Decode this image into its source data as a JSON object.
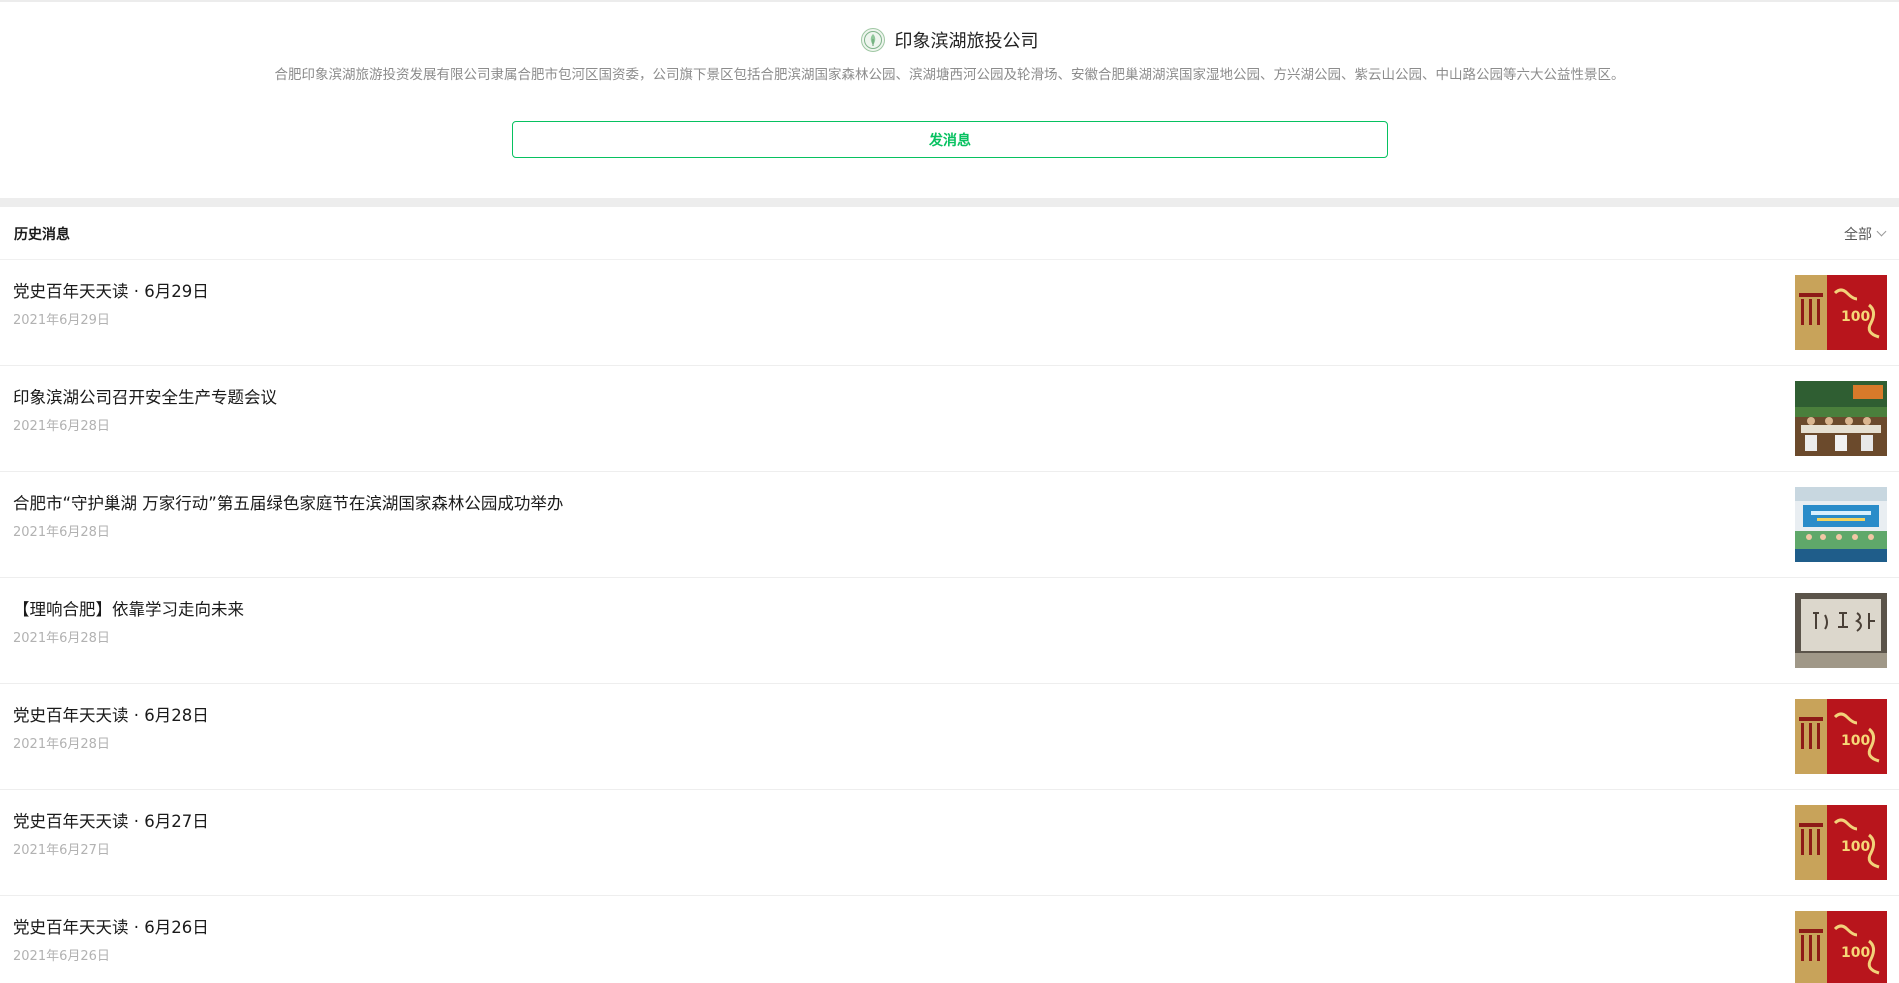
{
  "account": {
    "name": "印象滨湖旅投公司",
    "logo_icon": "green-circular-logo-icon",
    "description": "合肥印象滨湖旅游投资发展有限公司隶属合肥市包河区国资委，公司旗下景区包括合肥滨湖国家森林公园、滨湖塘西河公园及轮滑场、安徽合肥巢湖湖滨国家湿地公园、方兴湖公园、紫云山公园、中山路公园等六大公益性景区。",
    "send_message_label": "发消息",
    "accent_color": "#07c160"
  },
  "history": {
    "title": "历史消息",
    "filter_label": "全部",
    "filter_icon": "chevron-down-icon",
    "items": [
      {
        "title": "党史百年天天读 · 6月29日",
        "date": "2021年6月29日",
        "thumb": "party-history-100-years-thumbnail"
      },
      {
        "title": "印象滨湖公司召开安全生产专题会议",
        "date": "2021年6月28日",
        "thumb": "meeting-room-photo-thumbnail"
      },
      {
        "title": "合肥市“守护巢湖 万家行动”第五届绿色家庭节在滨湖国家森林公园成功举办",
        "date": "2021年6月28日",
        "thumb": "stage-event-photo-thumbnail"
      },
      {
        "title": "【理响合肥】依靠学习走向未来",
        "date": "2021年6月28日",
        "thumb": "calligraphy-wall-photo-thumbnail"
      },
      {
        "title": "党史百年天天读 · 6月28日",
        "date": "2021年6月28日",
        "thumb": "party-history-100-years-thumbnail"
      },
      {
        "title": "党史百年天天读 · 6月27日",
        "date": "2021年6月27日",
        "thumb": "party-history-100-years-thumbnail"
      },
      {
        "title": "党史百年天天读 · 6月26日",
        "date": "2021年6月26日",
        "thumb": "party-history-100-years-thumbnail"
      }
    ]
  }
}
